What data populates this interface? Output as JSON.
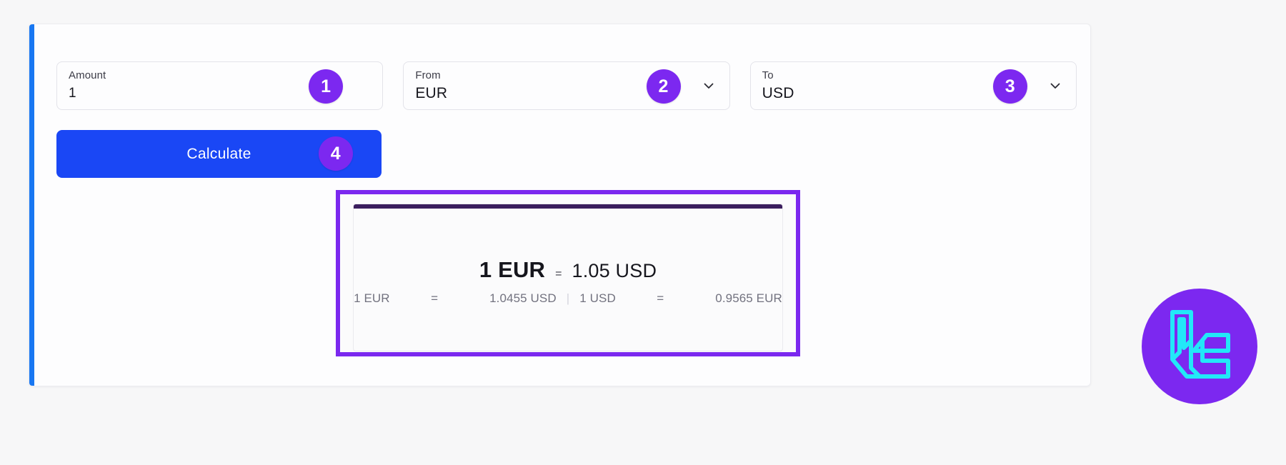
{
  "colors": {
    "page_background": "#f7f7f8",
    "card_background": "#fdfdfe",
    "card_accent": "#1877f2",
    "badge_purple": "#7c28f0",
    "calculate_blue": "#1a47f5",
    "highlight_border": "#7b28ef",
    "result_topbar": "#3b1e5e",
    "logo_cyan": "#22e8f8"
  },
  "form": {
    "amount": {
      "label": "Amount",
      "value": "1",
      "badge": "1"
    },
    "from": {
      "label": "From",
      "value": "EUR",
      "badge": "2",
      "chevron_icon": "chevron-down-icon"
    },
    "to": {
      "label": "To",
      "value": "USD",
      "badge": "3",
      "chevron_icon": "chevron-down-icon"
    },
    "calculate": {
      "label": "Calculate",
      "badge": "4"
    }
  },
  "result": {
    "headline": {
      "from_amount": "1 EUR",
      "equals": "=",
      "to_amount": "1.05 USD"
    },
    "rates": [
      {
        "label": "1 EUR",
        "sign": "=",
        "value": "1.0455 USD"
      },
      {
        "label": "1 USD",
        "sign": "=",
        "value": "0.9565 EUR"
      }
    ],
    "separator": "|"
  },
  "logo": {
    "icon": "brand-logo-icon"
  }
}
